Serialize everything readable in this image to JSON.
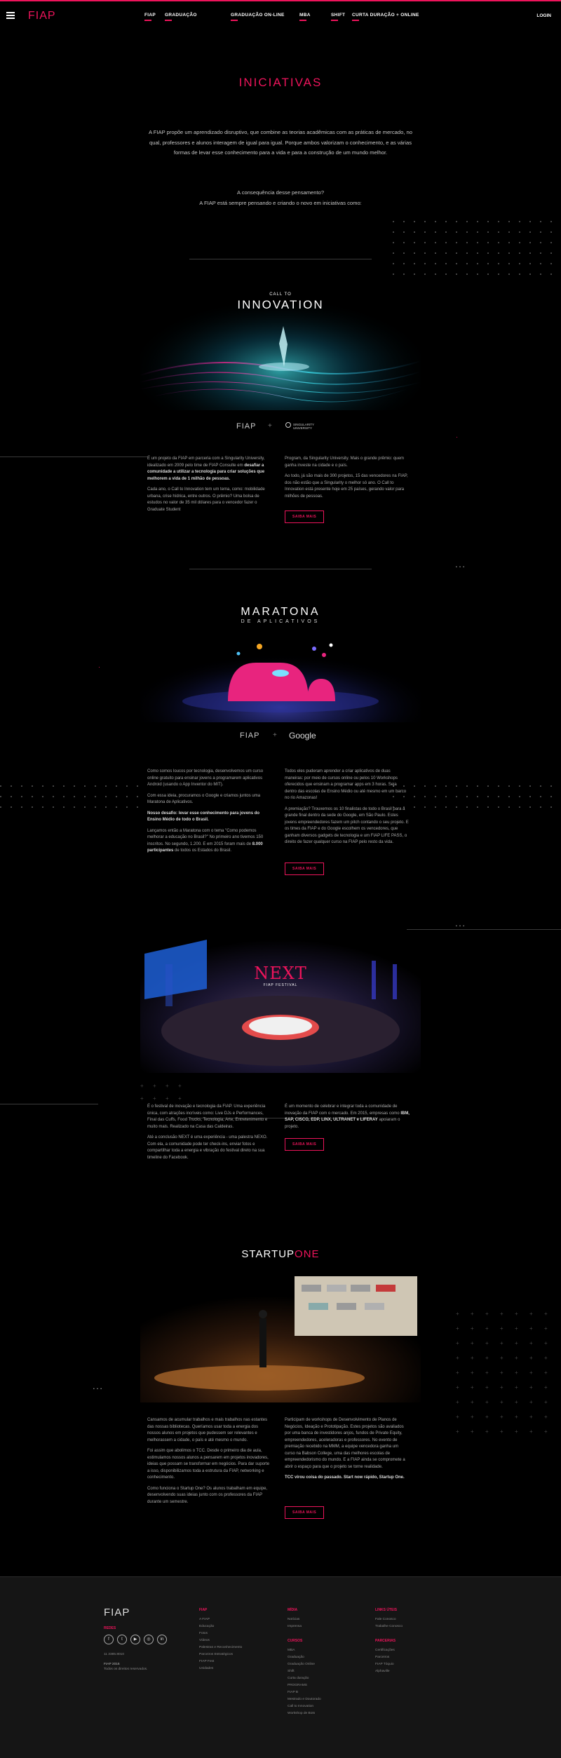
{
  "header": {
    "logo": "FIAP",
    "nav": [
      "FIAP",
      "GRADUAÇÃO",
      "GRADUAÇÃO ON-LINE",
      "MBA",
      "SHIFT",
      "CURTA DURAÇÃO + ONLINE"
    ],
    "login": "LOGIN"
  },
  "intro": {
    "title": "INICIATIVAS",
    "p1": "A FIAP propõe um aprendizado disruptivo, que combine as teorias acadêmicas com as práticas de mercado, no qual, professores e alunos interagem de igual para igual. Porque ambos valorizam o conhecimento, e as várias formas de levar esse conhecimento para a vida e para a construção de um mundo melhor.",
    "p2a": "A consequência desse pensamento?",
    "p2b": "A FIAP está sempre pensando e criando o novo em iniciativas como:"
  },
  "s1": {
    "title_small": "CALL TO",
    "title_big": "INNOVATION",
    "partner_a": "FIAP",
    "plus": "+",
    "partner_b": "SINGULARITY UNIVERSITY",
    "left_p1_a": "É um projeto da FIAP em parceria com a Singularity University, idealizado em 2009 pelo time de FIAP Consulte em ",
    "left_p1_b": "desafiar a comunidade a utilizar a tecnologia para criar soluções que melhorem a vida de 1 milhão de pessoas.",
    "left_p2": "Cada ano, o Call to Innovation tem um tema, como: mobilidade urbana, crise hídrica, entre outros. O prêmio? Uma bolsa de estudos no valor de 35 mil dólares para o vencedor fazer o Graduate Student",
    "right_p1": "Program, da Singularity University. Mais o grande prêmio: quem ganha investe na cidade e o país.",
    "right_p2": "Ao todo, já são mais de 300 projetos, 15 das vencedores na FIAP, dos não estão que a Singularity o melhor só ano. O Call to Innovation está presente hoje em 25 países, gerando valor para milhões de pessoas.",
    "button": "SAIBA MAIS"
  },
  "s2": {
    "title_big": "MARATONA",
    "title_small": "DE APLICATIVOS",
    "partner_a": "FIAP",
    "plus": "+",
    "partner_b": "Google",
    "left_p1": "Como somos loucos por tecnologia, desenvolvemos um curso online gratuito para ensinar jovens a programarem aplicativos Android (usando o App Inventor do MIT).",
    "left_p2": "Com essa ideia, procuramos o Google e criamos juntos uma Maratona de Aplicativos.",
    "left_p3_a": "Nosso desafio: levar esse conhecimento para jovens do Ensino Médio de todo o Brasil.",
    "left_p4_a": "Lançamos então a Maratona com o tema \"Como podemos melhorar a educação no Brasil?\" No primeiro ano tivemos 150 inscritos. No segundo, 1.200. E em 2015 foram mais de ",
    "left_p4_b": "8.000 participantes",
    "left_p4_c": " de todos os Estados do Brasil.",
    "right_p1": "Todos eles puderam aprender a criar aplicativos de duas maneiras: por meio de cursos online ou pelos 10 Workshops oferecidos que ensinam a programar apps em 3 horas. Seja dentro das escolas de Ensino Médio ou até mesmo em um barco no rio Amazonas!",
    "right_p2": "A premiação? Trouxemos os 10 finalistas de todo o Brasil para a grande final dentro da sede do Google, em São Paulo. Estes jovens empreendedores fazem um pitch contando o seu projeto. E os times da FIAP e do Google escolhem os vencedores, que ganham diversos gadgets de tecnologia e um FIAP LIFE PASS, o direito de fazer qualquer curso na FIAP pelo resto da vida.",
    "button": "SAIBA MAIS"
  },
  "s3": {
    "title": "NEXT",
    "subtitle": "FIAP FESTIVAL",
    "left_p1": "É o festival de inovação e tecnologia da FIAP. Uma experiência única, com atrações incríveis como: Live DJs e Performances, Final das Cuffs, Food Trucks, Tecnologia, Arte, Entretenimento e muito mais. Realizado na Casa das Caldeiras.",
    "left_p2": "Até a conclusão NEXT é uma experiência - uma palestra NEXO. Com ela, a comunidade pode ter check-ins, enviar fotos e compartilhar toda a energia e vibração do festival direto na sua timeline do Facebook.",
    "right_p1_a": "É um momento de celebrar e integrar toda a comunidade de inovação da FIAP com o mercado. Em 2015, empresas como ",
    "right_p1_b": "IBM, SAP, CISCO, EDP, LINX, ULTRANET e LIFERAY",
    "right_p1_c": " apoiaram o projeto.",
    "button": "SAIBA MAIS"
  },
  "s4": {
    "title_a": "STARTUP",
    "title_b": "ONE",
    "left_p1": "Cansamos de acumular trabalhos e mais trabalhos nas estantes das nossas bibliotecas. Queríamos usar toda a energia dos nossos alunos em projetos que pudessem ser relevantes e melhorassem a cidade, o país e até mesmo o mundo.",
    "left_p2": "Foi assim que abolimos o TCC. Desde o primeiro dia de aula, estimulamos nossos alunos a pensarem em projetos inovadores, ideias que possam se transformar em negócios. Para dar suporte a isso, disponibilizamos toda a estrutura da FIAP, networking e conhecimento.",
    "left_p3": "Como funciona o Startup One? Os alunos trabalham em equipe, desenvolvendo suas ideias junto com os professores da FIAP durante um semestre.",
    "right_p1": "Participam de workshops de Desenvolvimento de Planos de Negócios, Ideação e Prototipação. Estes projetos são avaliados por uma banca de investidores anjos, fundos de Private Equity, empreendedores, aceleradoras e professores. No evento de premiação recebido na MMM, a equipe vencedora ganha um curso na Babson College, uma das melhores escolas de empreendedorismo do mundo. E a FIAP ainda se compromete a abrir o espaço para que o projeto se torne realidade.",
    "right_p2_a": "",
    "right_p2_b": "TCC virou coisa do passado. Start now rápido, Startup One.",
    "button": "SAIBA MAIS"
  },
  "footer": {
    "logo": "FIAP",
    "social_label": "REDES",
    "social": [
      "f",
      "t",
      "▶",
      "◎",
      "in"
    ],
    "phone": "11 3385.8010",
    "copy1": "FIAP 2016",
    "copy2": "Todos os direitos reservados.",
    "col1_head": "FIAP",
    "col1": [
      "A FIAP",
      "Educação",
      "Fotos",
      "Vídeos",
      "Palestras e Reconhecimento",
      "Parceiros Estratégicos",
      "FIAP Fest",
      "Unidades"
    ],
    "col2_head": "MÍDIA",
    "col2": [
      "Notícias",
      "Imprensa"
    ],
    "col2b_head": "CURSOS",
    "col2b": [
      "MBA",
      "Graduação",
      "Graduação Online",
      "Shift",
      "Curta duração",
      "PROGRAMS",
      "FIAP B",
      "Mestrado e Doutorado",
      "Call to Innovation",
      "Workshop de Bots"
    ],
    "col3_head": "LINKS ÚTEIS",
    "col3": [
      "Fale Conosco",
      "Trabalhe Conosco"
    ],
    "col3b_head": "PARCERIAS",
    "col3b": [
      "Certificações",
      "Parceiros",
      "FIAP Tóquio",
      "Alphaville"
    ]
  }
}
